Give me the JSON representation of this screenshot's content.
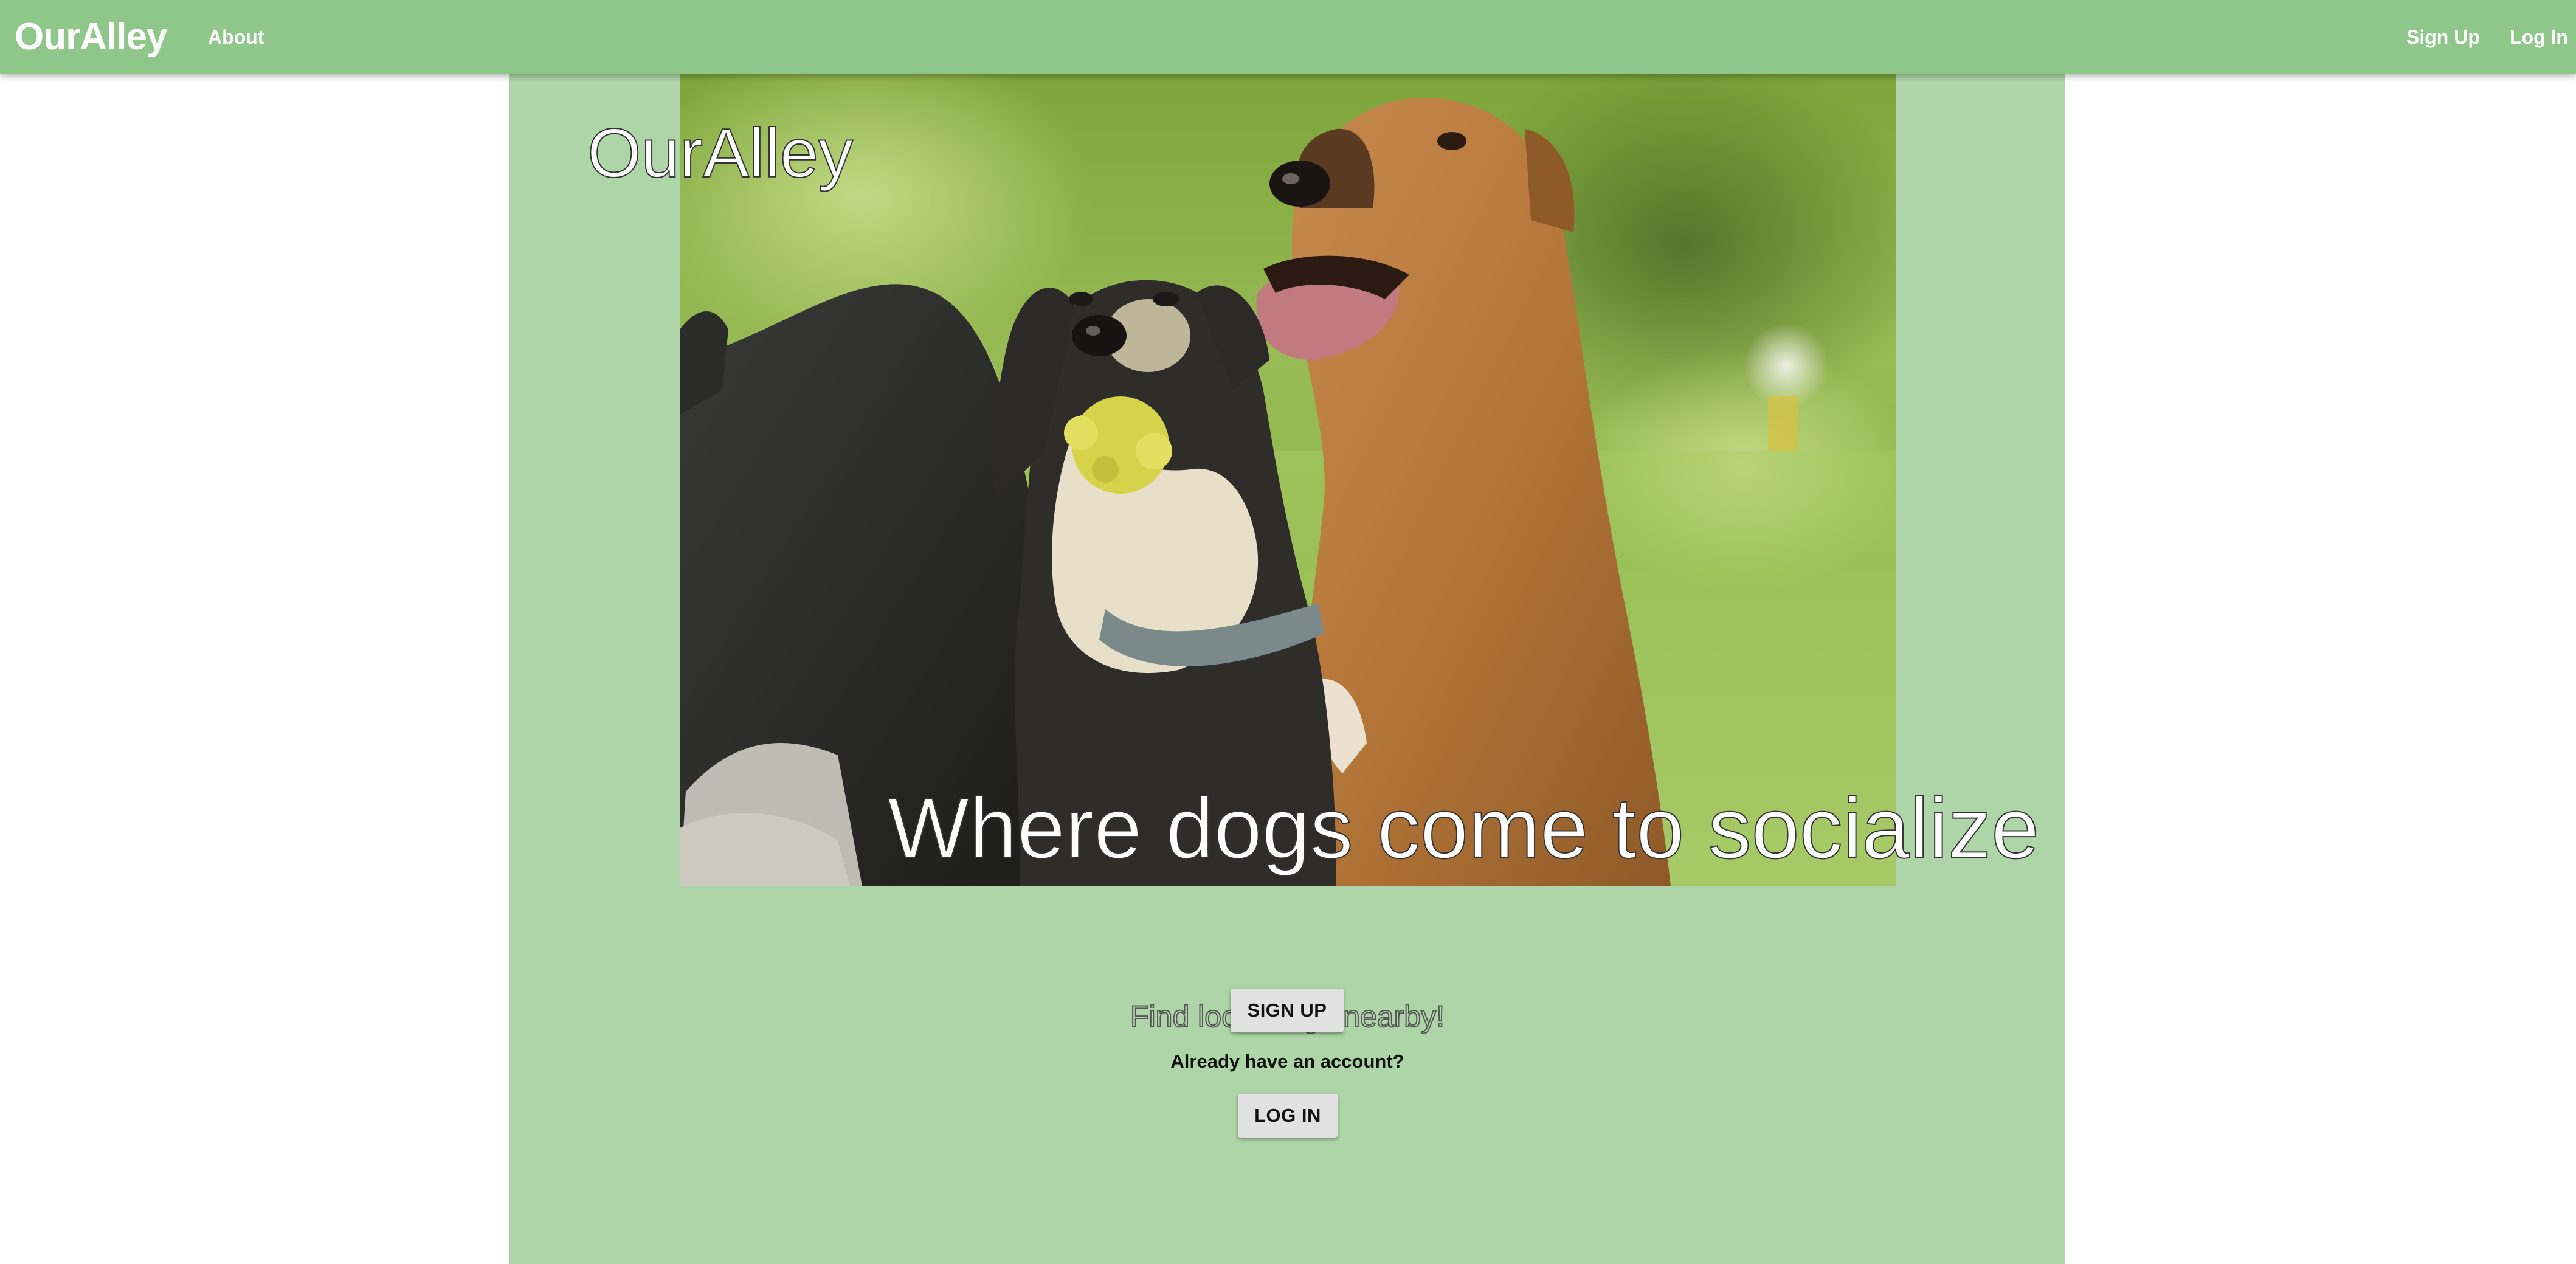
{
  "navbar": {
    "brand": "OurAlley",
    "about_label": "About",
    "signup_label": "Sign Up",
    "login_label": "Log In"
  },
  "hero": {
    "title": "OurAlley",
    "tagline": "Where dogs come to socialize"
  },
  "cta": {
    "find_text": "Find local dogs nearby!",
    "signup_button": "SIGN UP",
    "account_prompt": "Already have an account?",
    "login_button": "LOG IN"
  },
  "colors": {
    "navbar_bg": "#8fc68a",
    "main_bg": "#add5a7",
    "button_bg": "#e1e1e1"
  }
}
